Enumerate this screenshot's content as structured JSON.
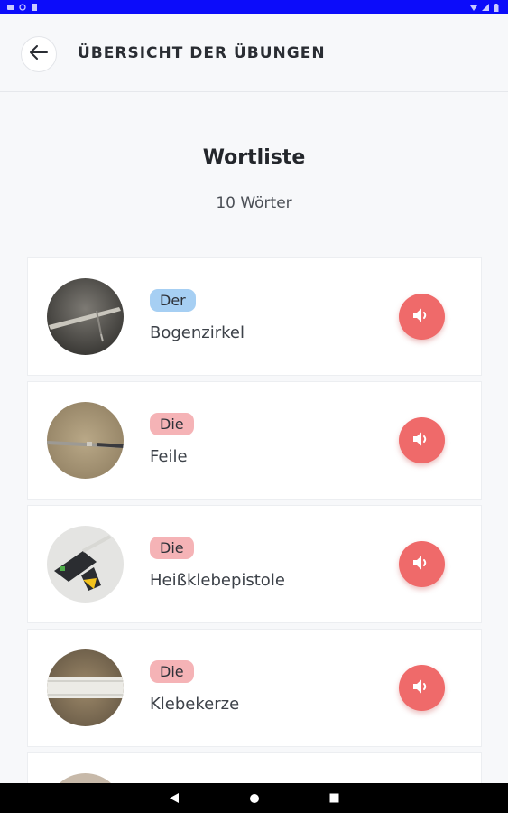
{
  "status_bar": {
    "time": "",
    "icons": [
      "app-icon",
      "sync-icon",
      "clipboard-icon",
      "wifi-icon",
      "battery-icon"
    ]
  },
  "header": {
    "title": "ÜBERSICHT DER ÜBUNGEN",
    "back_icon": "arrow-left-icon"
  },
  "main": {
    "title": "Wortliste",
    "count": "10 Wörter"
  },
  "words": [
    {
      "article": "Der",
      "article_color": "#a6cff3",
      "word": "Bogenzirkel",
      "image": "bogenzirkel-photo"
    },
    {
      "article": "Die",
      "article_color": "#f5b3b6",
      "word": "Feile",
      "image": "feile-photo"
    },
    {
      "article": "Die",
      "article_color": "#f5b3b6",
      "word": "Heißklebepistole",
      "image": "heissklebepistole-photo"
    },
    {
      "article": "Die",
      "article_color": "#f5b3b6",
      "word": "Klebekerze",
      "image": "klebekerze-photo"
    }
  ],
  "colors": {
    "accent": "#ef6a6a",
    "der_badge": "#a6cff3",
    "die_badge": "#f5b3b6",
    "status_bar": "#0c0cfa"
  },
  "nav_bar": {
    "icons": [
      "back-triangle-icon",
      "home-circle-icon",
      "recents-square-icon"
    ]
  }
}
